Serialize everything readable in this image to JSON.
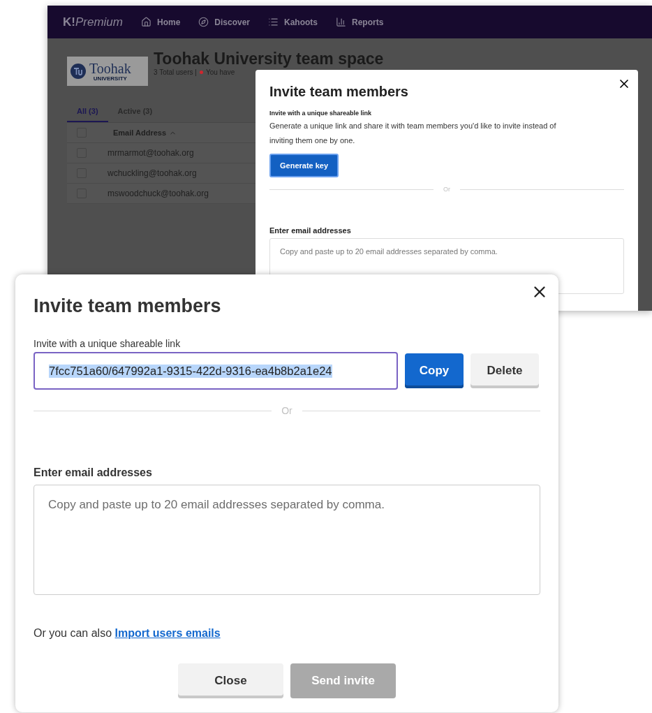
{
  "background_screen": {
    "nav": {
      "brand_mark": "K!",
      "brand_name": "Premium",
      "items": [
        {
          "label": "Home"
        },
        {
          "label": "Discover"
        },
        {
          "label": "Kahoots"
        },
        {
          "label": "Reports"
        }
      ]
    },
    "team": {
      "logo_name": "Toohak",
      "logo_sub": "UNIVERSITY",
      "title": "Toohak University team space",
      "total_users": "3 Total users |",
      "notice": "You have"
    },
    "tabs": [
      {
        "label": "All (3)",
        "selected": true
      },
      {
        "label": "Active (3)",
        "selected": false
      }
    ],
    "table": {
      "header_checked": false,
      "columns": [
        {
          "label": "Email Address"
        }
      ],
      "rows": [
        {
          "email": "mrmarmot@toohak.org",
          "checked": false
        },
        {
          "email": "wchuckling@toohak.org",
          "checked": false
        },
        {
          "email": "mswoodchuck@toohak.org",
          "checked": false
        }
      ]
    },
    "modal": {
      "title": "Invite team members",
      "link_heading": "Invite with a unique shareable link",
      "link_description": "Generate a unique link and share it with team members you'd like to invite instead of inviting them one by one.",
      "generate_button": "Generate key",
      "divider": "Or",
      "email_label": "Enter email addresses",
      "email_placeholder": "Copy and paste up to 20 email addresses separated by comma."
    }
  },
  "dialog": {
    "title": "Invite team members",
    "link_label": "Invite with a unique shareable link",
    "link_value": "7fcc751a60/647992a1-9315-422d-9316-ea4b8b2a1e24",
    "link_text_selected": true,
    "copy_button": "Copy",
    "delete_button": "Delete",
    "divider": "Or",
    "email_label": "Enter email addresses",
    "email_placeholder": "Copy and paste up to 20 email addresses separated by comma.",
    "import_prefix": "Or you can also",
    "import_link": "Import users emails",
    "close_button": "Close",
    "send_button": {
      "label": "Send invite",
      "disabled": true
    }
  }
}
